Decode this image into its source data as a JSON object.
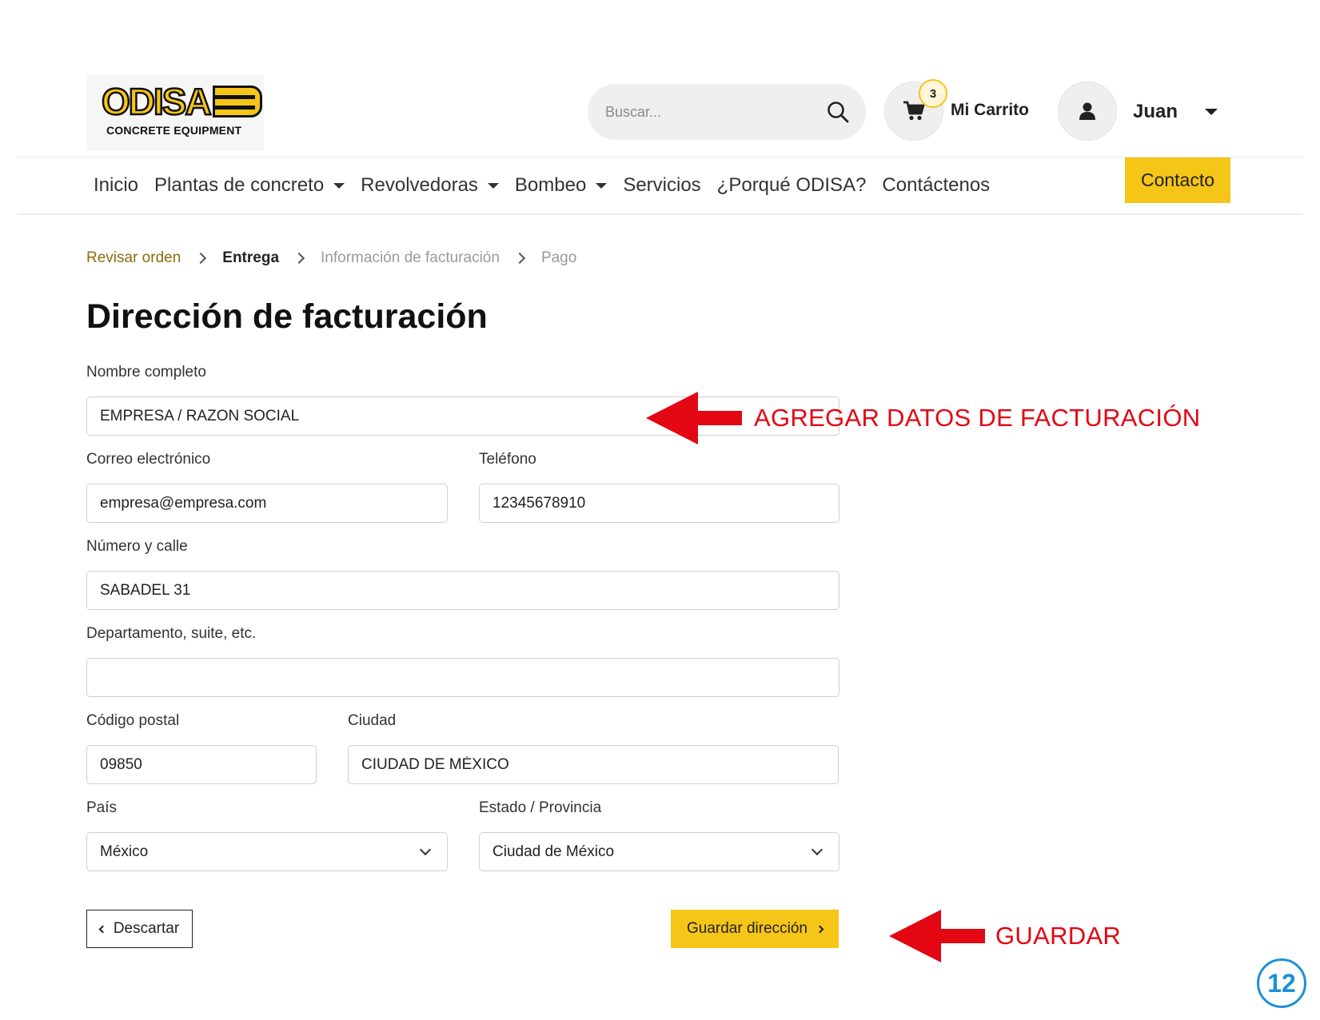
{
  "brand": {
    "logo_word": "ODISA",
    "logo_sub": "CONCRETE EQUIPMENT",
    "accent": "#f5c518"
  },
  "header": {
    "search_placeholder": "Buscar...",
    "cart_count": "3",
    "cart_label": "Mi Carrito",
    "user_name": "Juan"
  },
  "nav": {
    "items": [
      {
        "label": "Inicio"
      },
      {
        "label": "Plantas de concreto"
      },
      {
        "label": "Revolvedoras"
      },
      {
        "label": "Bombeo"
      },
      {
        "label": "Servicios"
      },
      {
        "label": "¿Porqué ODISA?"
      },
      {
        "label": "Contáctenos"
      }
    ],
    "contact_button": "Contacto"
  },
  "breadcrumb": {
    "step1": "Revisar orden",
    "step2": "Entrega",
    "step3": "Información de facturación",
    "step4": "Pago"
  },
  "page": {
    "title": "Dirección de facturación"
  },
  "form": {
    "full_name": {
      "label": "Nombre completo",
      "value": "EMPRESA / RAZON SOCIAL"
    },
    "email": {
      "label": "Correo electrónico",
      "value": "empresa@empresa.com"
    },
    "phone": {
      "label": "Teléfono",
      "value": "12345678910"
    },
    "street": {
      "label": "Número y calle",
      "value": "SABADEL 31"
    },
    "apartment": {
      "label": "Departamento, suite, etc.",
      "value": ""
    },
    "postal_code": {
      "label": "Código postal",
      "value": "09850"
    },
    "city": {
      "label": "Ciudad",
      "value": "CIUDAD DE MÉXICO"
    },
    "country": {
      "label": "País",
      "value": "México"
    },
    "state": {
      "label": "Estado / Provincia",
      "value": "Ciudad de México"
    },
    "discard_label": "Descartar",
    "save_label": "Guardar dirección"
  },
  "annotations": {
    "billing_note": "AGREGAR DATOS DE FACTURACIÓN",
    "save_note": "GUARDAR",
    "color": "#e30613"
  },
  "page_number": "12"
}
